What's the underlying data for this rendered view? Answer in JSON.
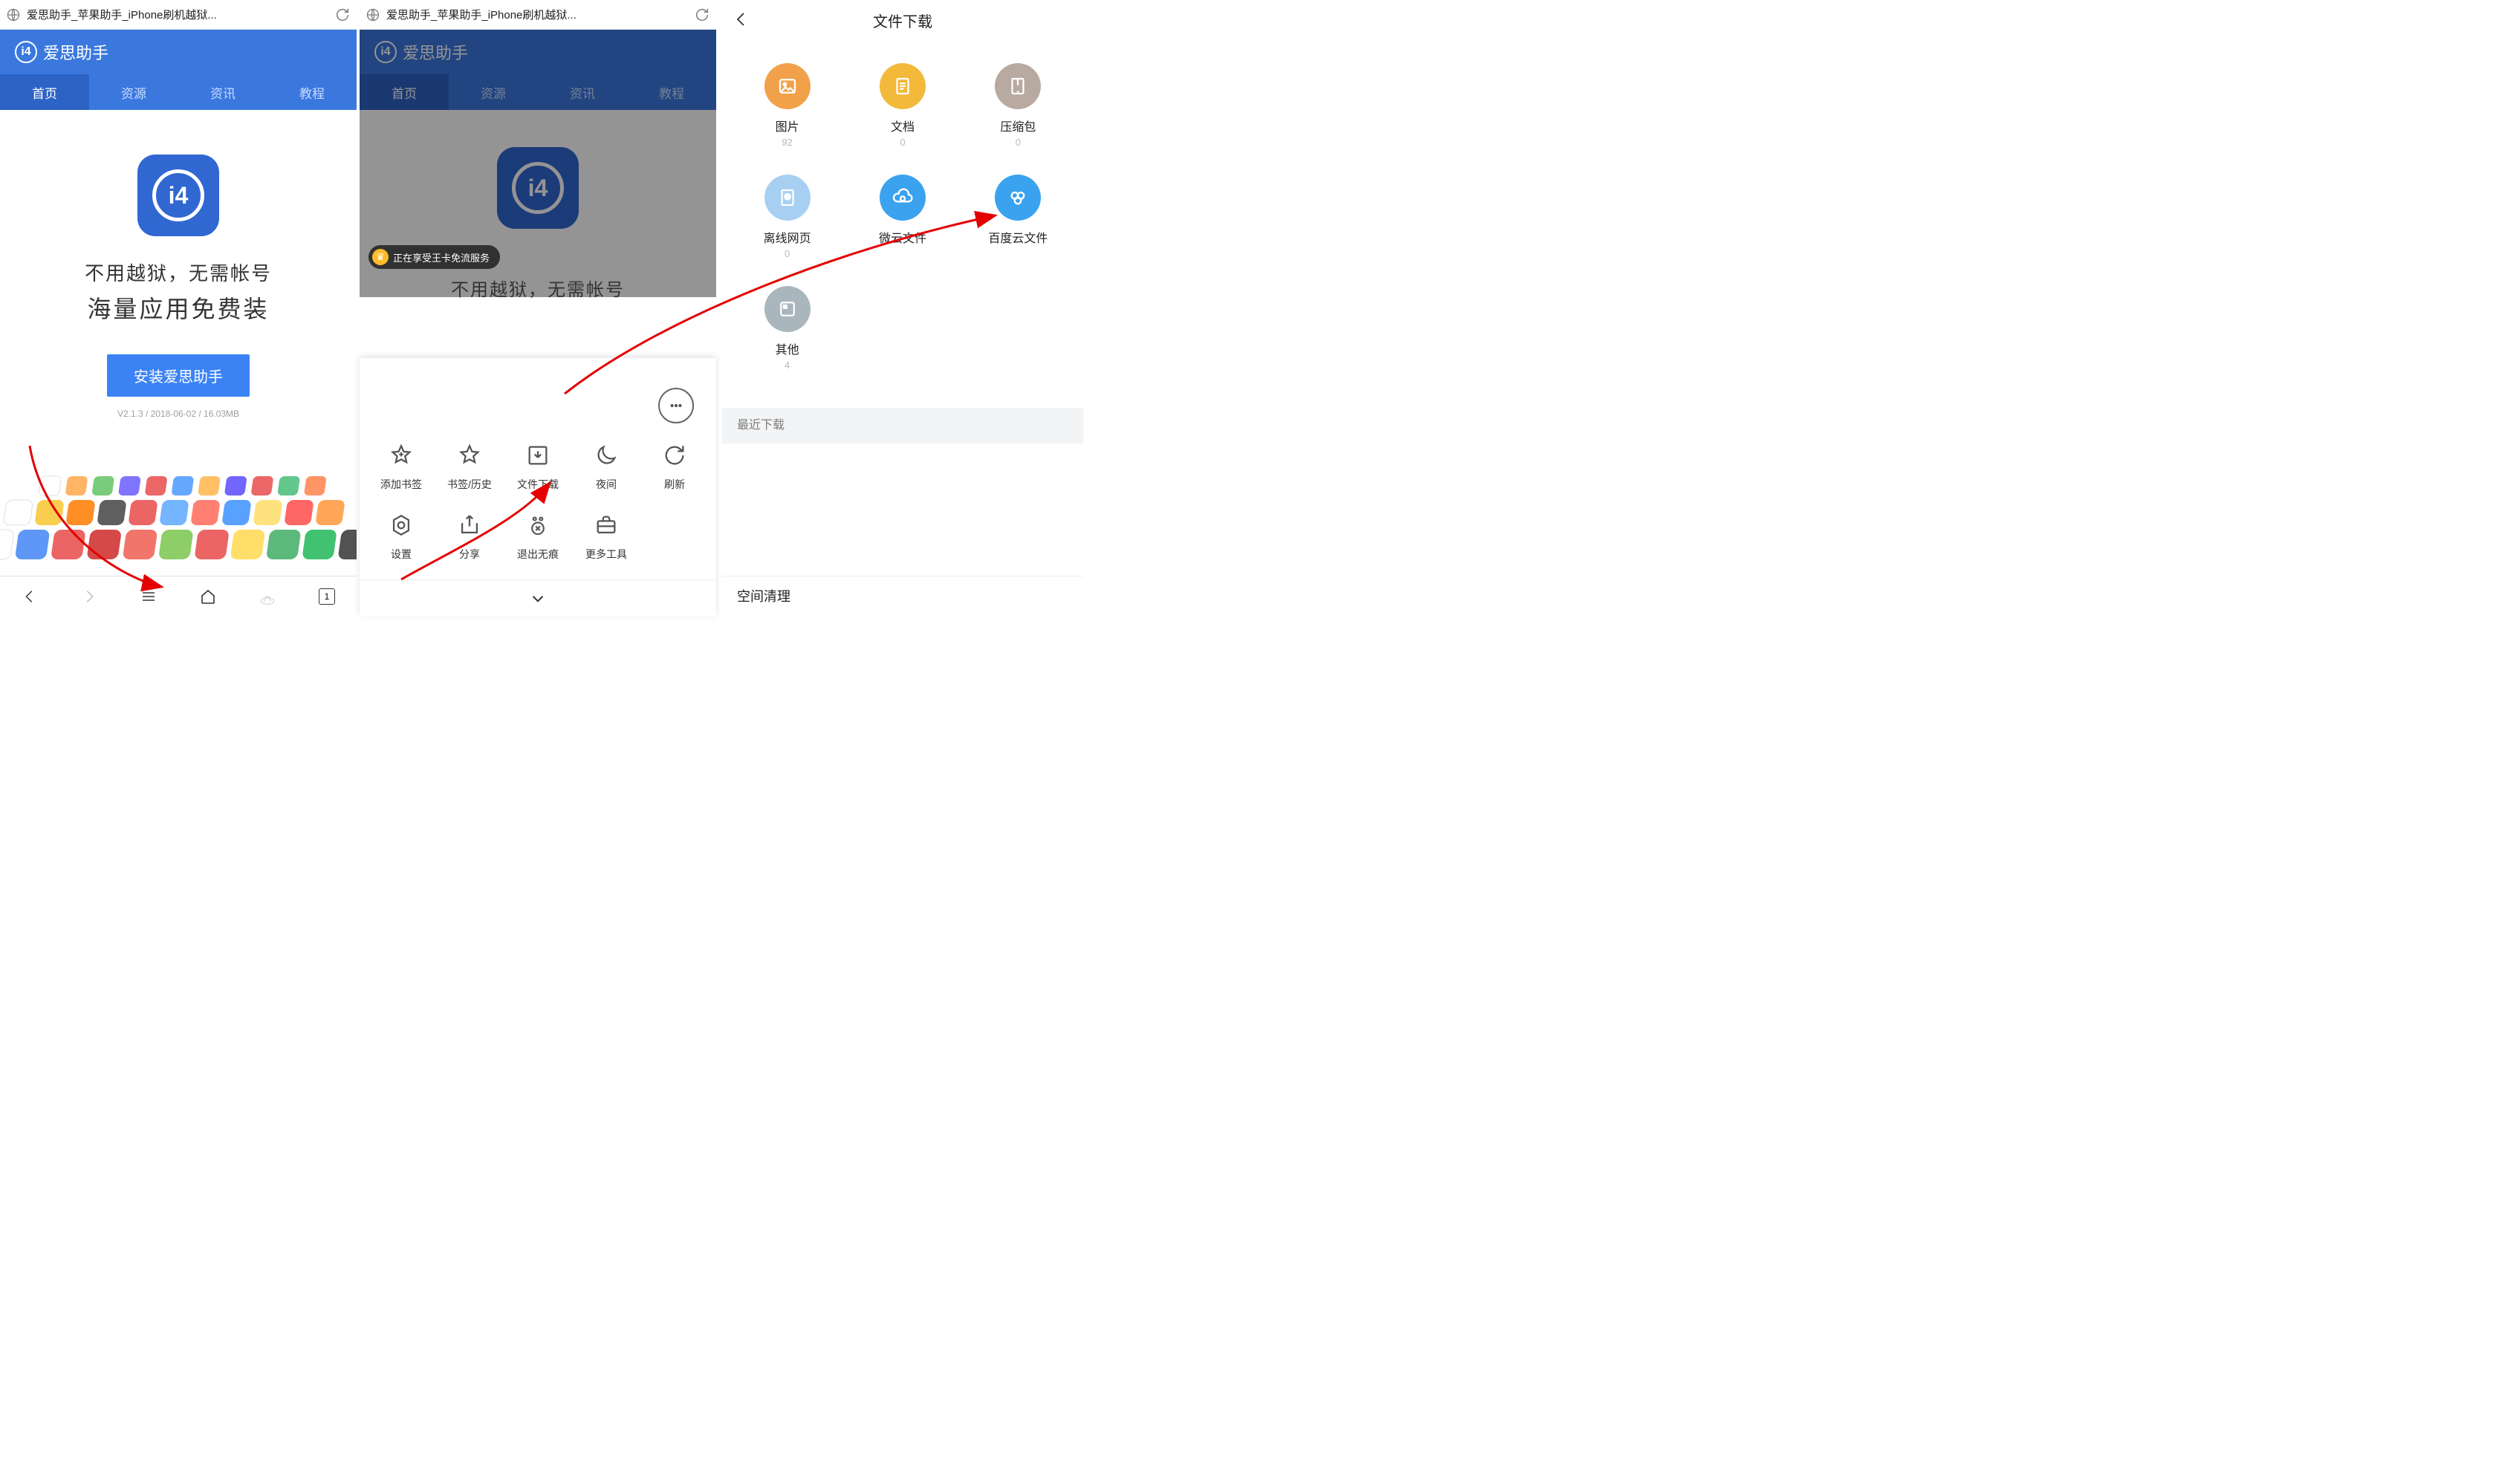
{
  "addressbar": {
    "title": "爱思助手_苹果助手_iPhone刷机越狱..."
  },
  "brand": "爱思助手",
  "tabs": [
    "首页",
    "资源",
    "资讯",
    "教程"
  ],
  "page": {
    "line1": "不用越狱，无需帐号",
    "line2": "海量应用免费装",
    "install_btn": "安装爱思助手",
    "meta": "V2.1.3 / 2018-06-02 / 16.03MB",
    "truncated": "不用越狱，无需帐号"
  },
  "bottom_nav": {
    "tab_count": "1"
  },
  "banner": "正在享受王卡免流服务",
  "menu": {
    "chat": "...",
    "row1": [
      {
        "name": "add-bookmark",
        "label": "添加书签"
      },
      {
        "name": "bookmarks-history",
        "label": "书签/历史"
      },
      {
        "name": "file-download",
        "label": "文件下载"
      },
      {
        "name": "night-mode",
        "label": "夜间"
      },
      {
        "name": "refresh",
        "label": "刷新"
      }
    ],
    "row2": [
      {
        "name": "settings",
        "label": "设置"
      },
      {
        "name": "share",
        "label": "分享"
      },
      {
        "name": "exit-incognito",
        "label": "退出无痕"
      },
      {
        "name": "more-tools",
        "label": "更多工具"
      }
    ]
  },
  "panel3": {
    "title": "文件下载",
    "categories": [
      {
        "name": "images",
        "label": "图片",
        "count": "92",
        "color": "#f0a14a"
      },
      {
        "name": "documents",
        "label": "文档",
        "count": "0",
        "color": "#f2b93b"
      },
      {
        "name": "archives",
        "label": "压缩包",
        "count": "0",
        "color": "#b8aaa1"
      },
      {
        "name": "offline-pages",
        "label": "离线网页",
        "count": "0",
        "color": "#4da3ef"
      },
      {
        "name": "weiyun-files",
        "label": "微云文件",
        "count": "",
        "color": "#3aa2ee"
      },
      {
        "name": "baidu-cloud-files",
        "label": "百度云文件",
        "count": "",
        "color": "#3aa2ee"
      },
      {
        "name": "other",
        "label": "其他",
        "count": "4",
        "color": "#aab6bd"
      }
    ],
    "recent_section": "最近下载",
    "footer": "空间清理"
  }
}
